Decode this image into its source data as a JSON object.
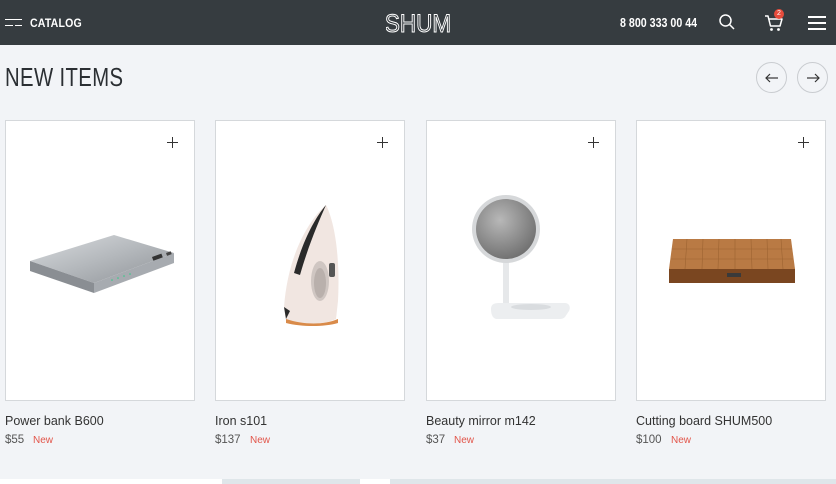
{
  "header": {
    "catalog_label": "CATALOG",
    "logo_text": "SHUM",
    "phone": "8 800 333 00 44",
    "cart_count": "2",
    "background": "#363c40"
  },
  "section": {
    "title": "NEW ITEMS"
  },
  "products": [
    {
      "name": "Power bank B600",
      "price": "$55",
      "badge": "New",
      "image": "power-bank"
    },
    {
      "name": "Iron s101",
      "price": "$137",
      "badge": "New",
      "image": "iron"
    },
    {
      "name": "Beauty mirror m142",
      "price": "$37",
      "badge": "New",
      "image": "mirror"
    },
    {
      "name": "Cutting board SHUM500",
      "price": "$100",
      "badge": "New",
      "image": "cutting-board"
    }
  ],
  "colors": {
    "badge": "#e2554a",
    "page_background": "#f2f4f7"
  }
}
